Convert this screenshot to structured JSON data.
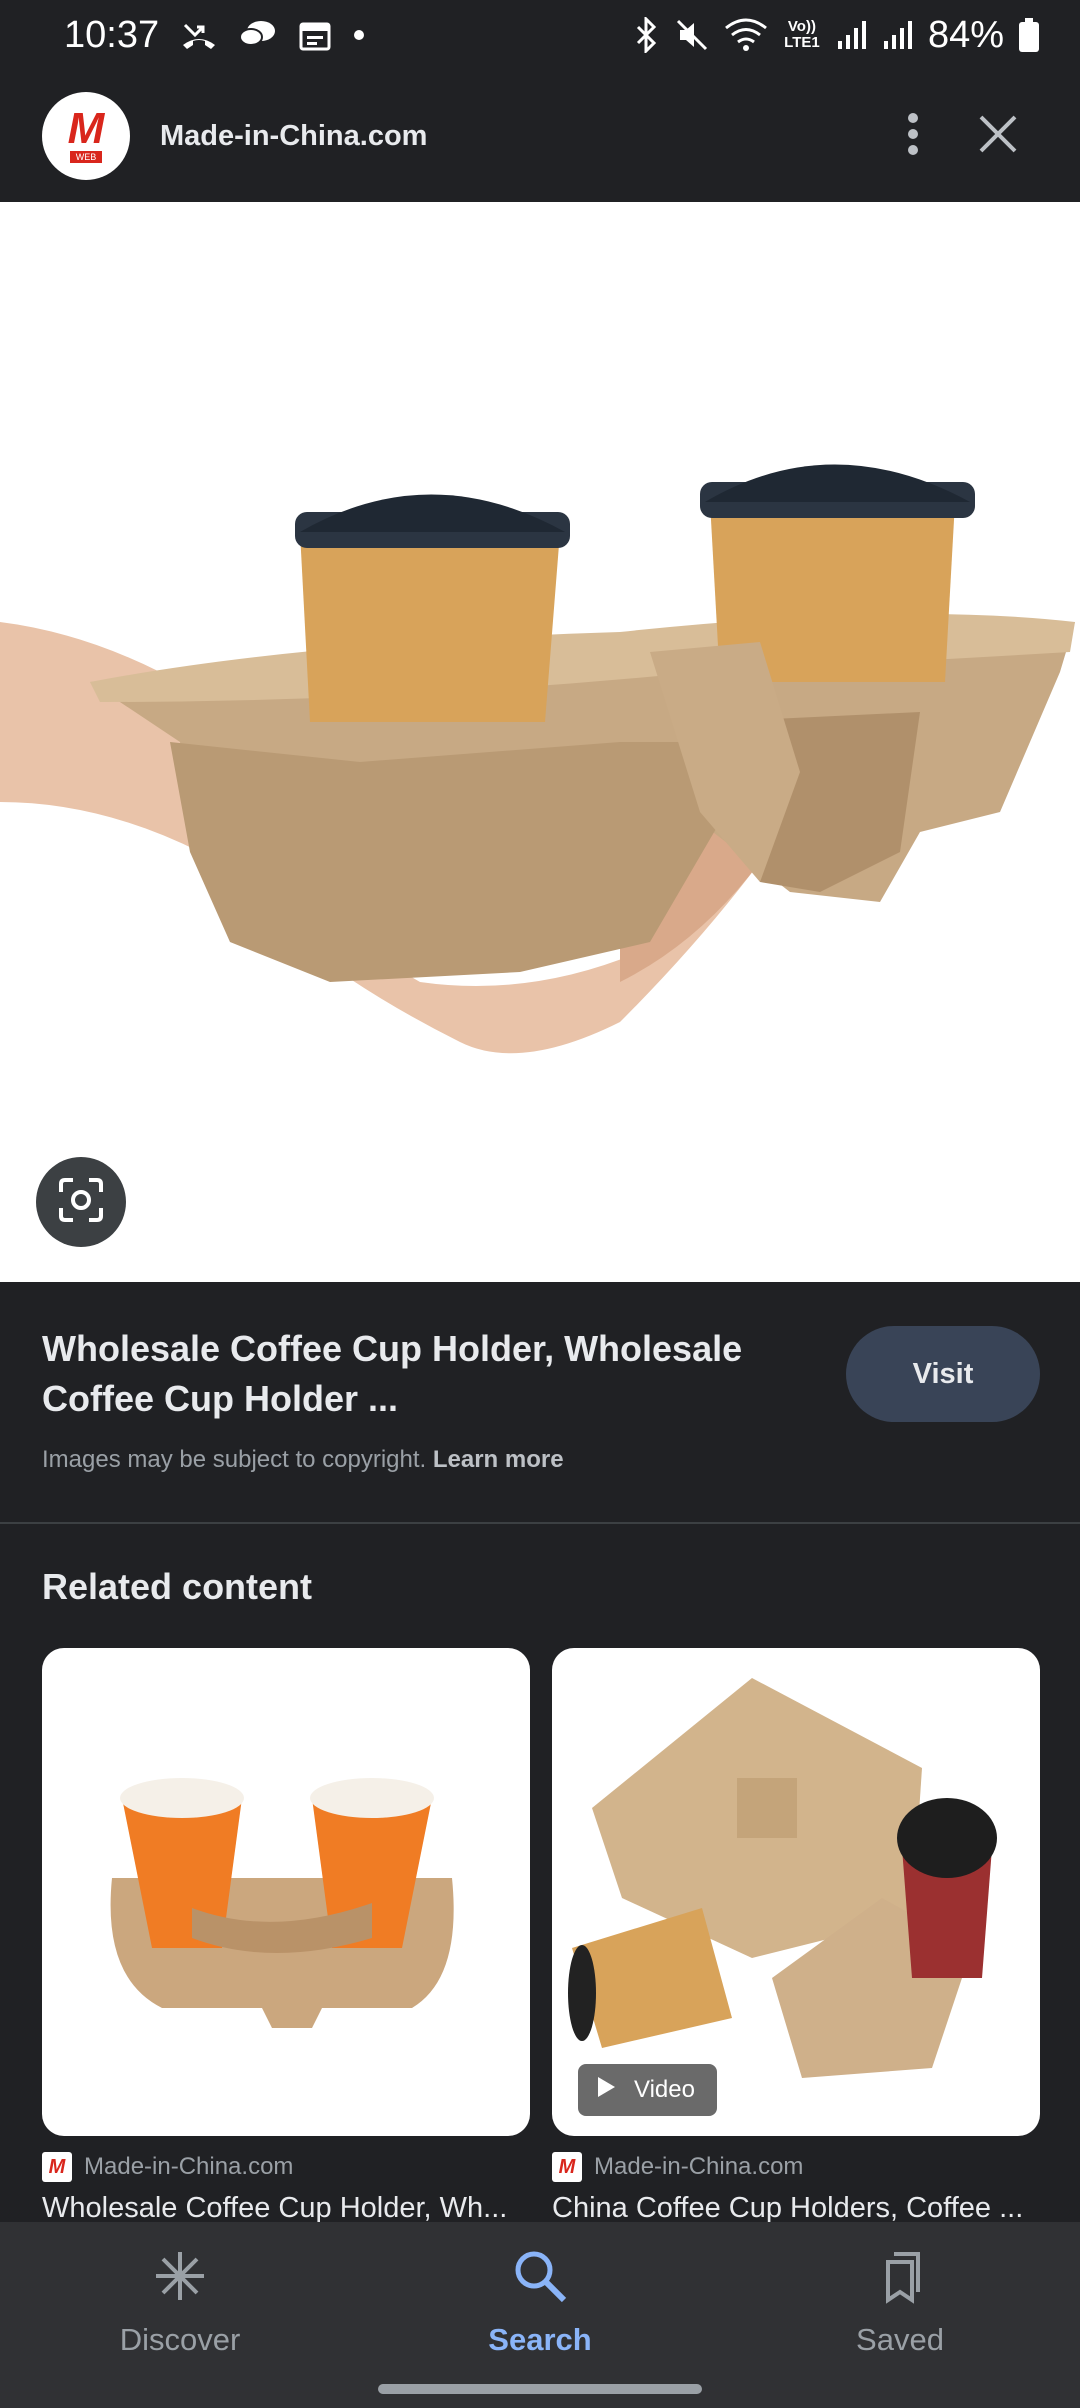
{
  "status_bar": {
    "time": "10:37",
    "battery": "84%",
    "network_label": "Vo)) LTE1"
  },
  "header": {
    "site_name": "Made-in-China.com",
    "logo_letter": "M",
    "logo_sub": "WEB"
  },
  "image": {
    "subject": "coffee-cup-holder-tray"
  },
  "info": {
    "title": "Wholesale Coffee Cup Holder, Wholesale Coffee Cup Holder ...",
    "visit_label": "Visit",
    "copyright_text": "Images may be subject to copyright.",
    "learn_more": "Learn more"
  },
  "related": {
    "heading": "Related content",
    "items": [
      {
        "source": "Made-in-China.com",
        "title": "Wholesale Coffee Cup Holder, Wh...",
        "has_video": false
      },
      {
        "source": "Made-in-China.com",
        "title": "China Coffee Cup Holders, Coffee ...",
        "has_video": true,
        "video_label": "Video"
      }
    ]
  },
  "bottom_nav": {
    "items": [
      {
        "label": "Discover",
        "icon": "asterisk-icon",
        "active": false
      },
      {
        "label": "Search",
        "icon": "search-icon",
        "active": true
      },
      {
        "label": "Saved",
        "icon": "bookmark-icon",
        "active": false
      }
    ]
  },
  "colors": {
    "background": "#202124",
    "accent": "#8ab4f8",
    "visit_button": "#394457",
    "brand_red": "#d9261c"
  }
}
